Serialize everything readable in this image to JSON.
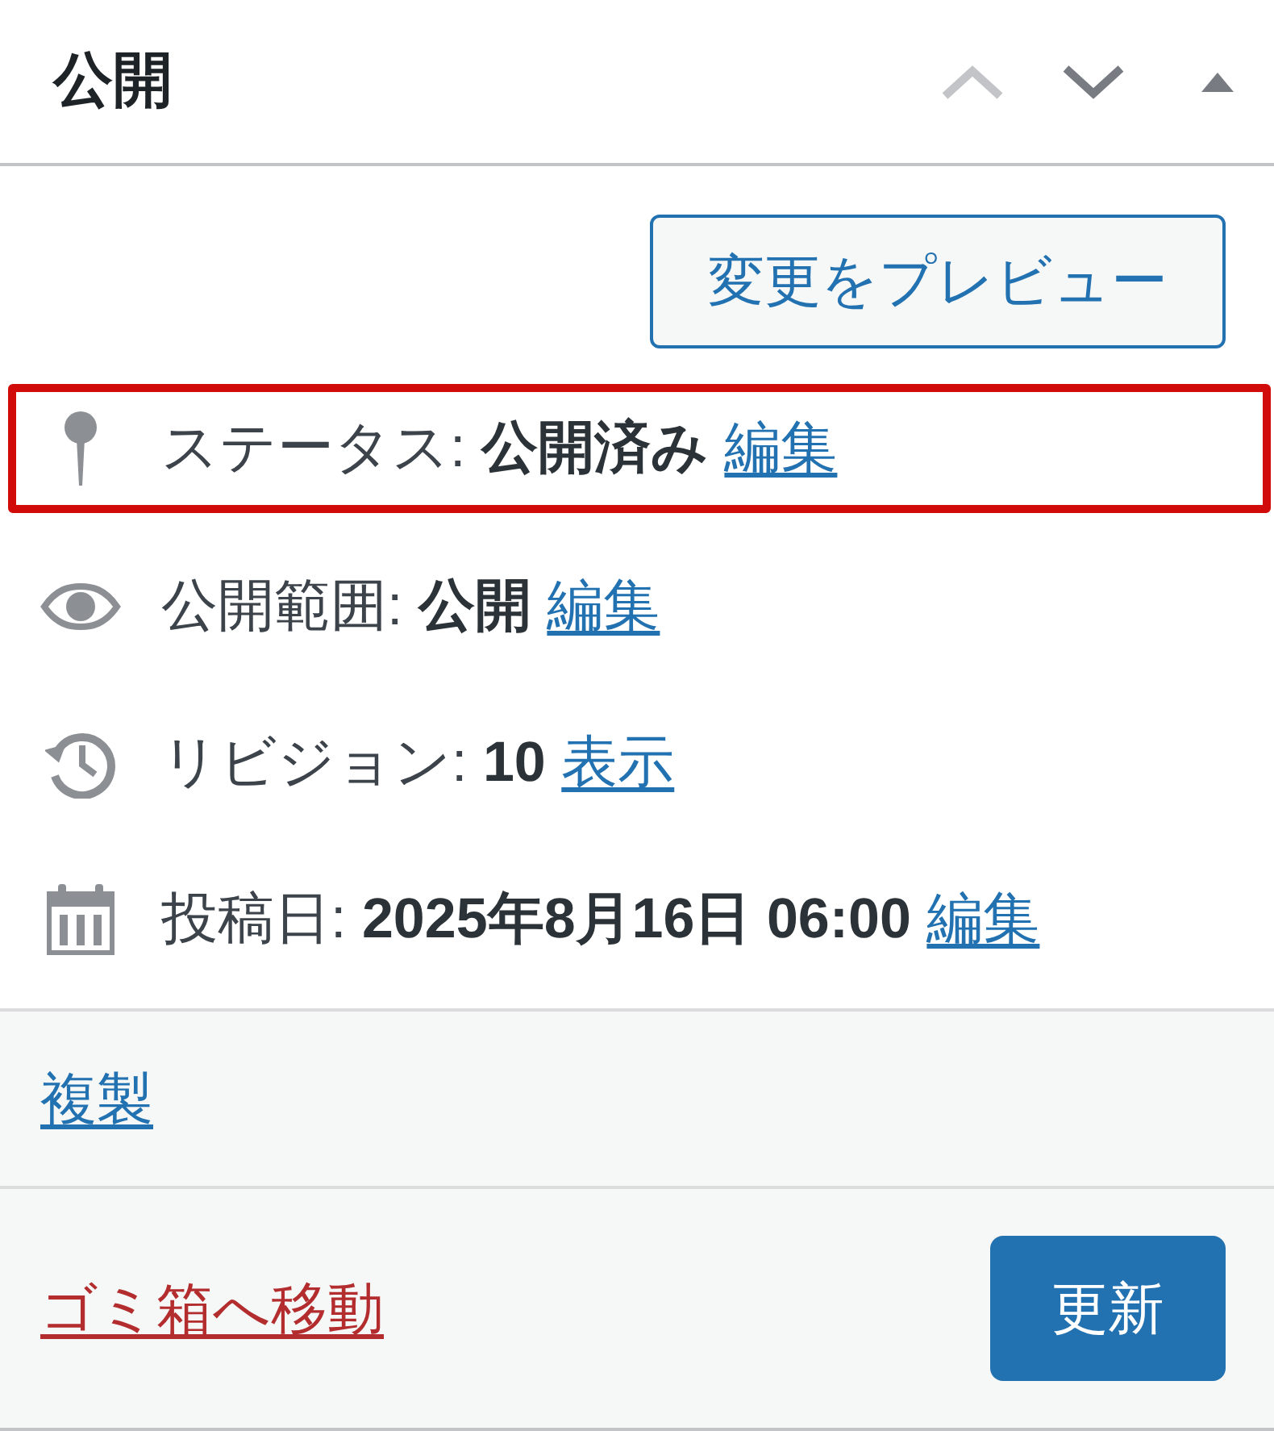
{
  "panel": {
    "title": "公開",
    "controls": [
      {
        "kind": "move_up",
        "disabled": true
      },
      {
        "kind": "move_down",
        "disabled": false
      },
      {
        "kind": "toggle",
        "expanded": true
      }
    ]
  },
  "preview_button": "変更をプレビュー",
  "rows": [
    {
      "kind": "status",
      "label": "ステータス:",
      "value": "公開済み",
      "link": "編集",
      "highlighted": true
    },
    {
      "kind": "visibility",
      "label": "公開範囲:",
      "value": "公開",
      "link": "編集",
      "highlighted": false
    },
    {
      "kind": "revisions",
      "label": "リビジョン:",
      "value": "10",
      "link": "表示",
      "highlighted": false
    },
    {
      "kind": "date",
      "label": "投稿日:",
      "value": "2025年8月16日 06:00",
      "link": "編集",
      "highlighted": false
    }
  ],
  "duplicate_link": "複製",
  "trash_link": "ゴミ箱へ移動",
  "update_button": "更新"
}
